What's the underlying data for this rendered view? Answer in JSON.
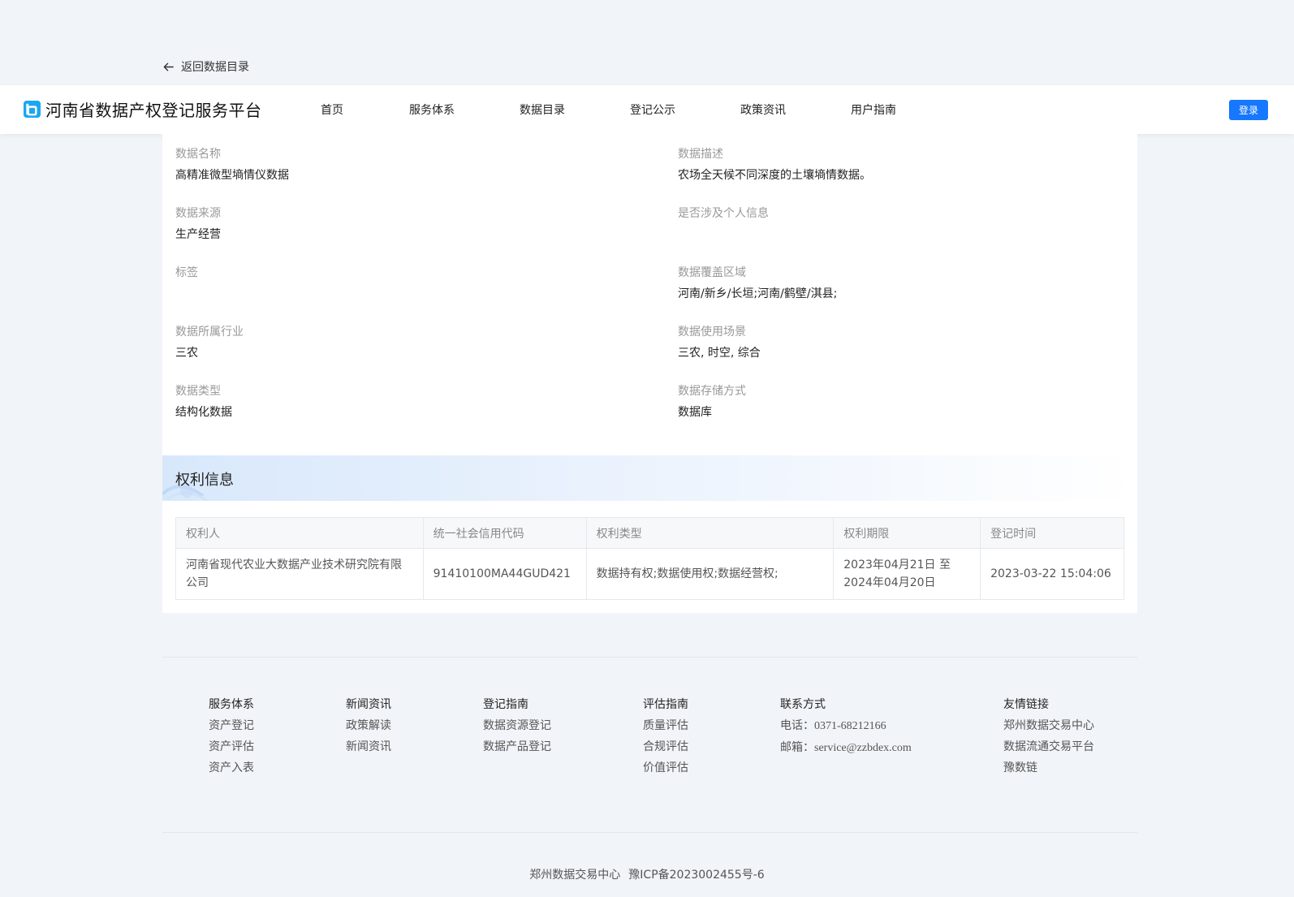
{
  "back_link": {
    "label": "返回数据目录"
  },
  "header": {
    "title": "河南省数据产权登记服务平台",
    "nav": [
      "首页",
      "服务体系",
      "数据目录",
      "登记公示",
      "政策资讯",
      "用户指南"
    ],
    "login_label": "登录",
    "accent_color": "#1677ff"
  },
  "details": {
    "name": {
      "label": "数据名称",
      "value": "高精准微型墒情仪数据"
    },
    "description": {
      "label": "数据描述",
      "value": "农场全天候不同深度的土壤墒情数据。"
    },
    "source": {
      "label": "数据来源",
      "value": "生产经营"
    },
    "personal_info": {
      "label": "是否涉及个人信息",
      "value": ""
    },
    "tags": {
      "label": "标签",
      "value": ""
    },
    "coverage": {
      "label": "数据覆盖区域",
      "value": "河南/新乡/长垣;河南/鹤壁/淇县;"
    },
    "industry": {
      "label": "数据所属行业",
      "value": "三农"
    },
    "scenario": {
      "label": "数据使用场景",
      "value": "三农, 时空, 综合"
    },
    "type": {
      "label": "数据类型",
      "value": "结构化数据"
    },
    "storage": {
      "label": "数据存储方式",
      "value": "数据库"
    }
  },
  "rights": {
    "title": "权利信息",
    "columns": [
      "权利人",
      "统一社会信用代码",
      "权利类型",
      "权利期限",
      "登记时间"
    ],
    "rows": [
      {
        "holder_line1": "河南省现代农业大数据产业技术研究院有限",
        "holder_line2": "公司",
        "credit_code": "91410100MA44GUD421",
        "rights_type": "数据持有权;数据使用权;数据经营权;",
        "period_line1": "2023年04月21日 至",
        "period_line2": "2024年04月20日",
        "registered_at": "2023-03-22 15:04:06"
      }
    ]
  },
  "footer": {
    "services": {
      "title": "服务体系",
      "items": [
        "资产登记",
        "资产评估",
        "资产入表"
      ]
    },
    "news": {
      "title": "新闻资讯",
      "items": [
        "政策解读",
        "新闻资讯"
      ]
    },
    "registration_guide": {
      "title": "登记指南",
      "items": [
        "数据资源登记",
        "数据产品登记"
      ]
    },
    "evaluation_guide": {
      "title": "评估指南",
      "items": [
        "质量评估",
        "合规评估",
        "价值评估"
      ]
    },
    "contact": {
      "title": "联系方式",
      "phone_label": "电话：",
      "phone": "0371-68212166",
      "email_label": "邮箱：",
      "email": "service@zzbdex.com"
    },
    "links": {
      "title": "友情链接",
      "items": [
        "郑州数据交易中心",
        "数据流通交易平台",
        "豫数链"
      ]
    },
    "copyright_org": "郑州数据交易中心",
    "icp": "豫ICP备2023002455号-6"
  }
}
